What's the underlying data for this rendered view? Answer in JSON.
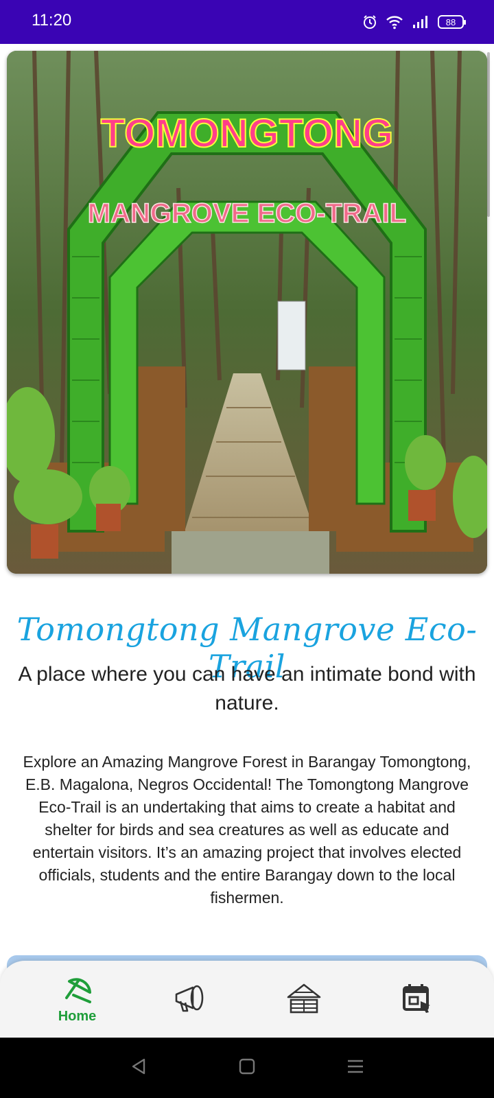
{
  "status_bar": {
    "time": "11:20",
    "battery": "88",
    "icons": [
      "alarm-icon",
      "wifi-icon",
      "signal-icon",
      "battery-icon"
    ],
    "background": "#3a04b4"
  },
  "hero": {
    "sign_top": "TOMONGTONG",
    "sign_bottom": "MANGROVE ECO-TRAIL"
  },
  "main": {
    "title": "Tomongtong Mangrove Eco-Trail",
    "tagline": "A place where you can have an intimate bond with nature.",
    "description": "Explore an Amazing Mangrove Forest in Barangay Tomongtong, E.B. Magalona, Negros Occidental! The Tomongtong Mangrove Eco-Trail is an undertaking that aims to create a habitat and shelter for birds and sea creatures as well as educate and entertain visitors. It’s an amazing project that involves elected officials, students and the entire Barangay down to the local fishermen."
  },
  "bottom_nav": {
    "items": [
      {
        "label": "Home",
        "icon": "umbrella-home-icon",
        "active": true
      },
      {
        "label": "",
        "icon": "megaphone-icon",
        "active": false
      },
      {
        "label": "",
        "icon": "cottage-icon",
        "active": false
      },
      {
        "label": "",
        "icon": "calendar-icon",
        "active": false
      }
    ],
    "active_color": "#1f9e3a"
  },
  "system_nav": [
    "back-icon",
    "home-square-icon",
    "recents-icon"
  ]
}
